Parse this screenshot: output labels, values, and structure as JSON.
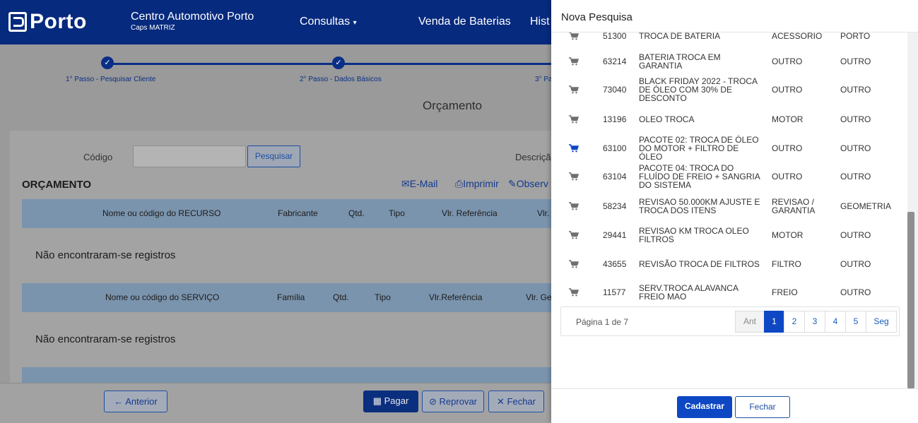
{
  "navbar": {
    "logo": "Porto",
    "company_name": "Centro Automotivo Porto",
    "company_sub": "Caps MATRIZ",
    "links": [
      "Consultas",
      "Venda de Baterias",
      "Hist"
    ]
  },
  "stepper": {
    "steps": [
      "1° Passo - Pesquisar Cliente",
      "2° Passo - Dados Básicos",
      "3° Pa"
    ]
  },
  "main": {
    "title": "Orçamento",
    "code_label": "Código",
    "search_button": "Pesquisar",
    "desc_label": "Descriçã",
    "section_title": "ORÇAMENTO",
    "actions": [
      "E-Mail",
      "Imprimir",
      "Observ"
    ],
    "resources_table": {
      "headers": [
        "Nome ou código do RECURSO",
        "Fabricante",
        "Qtd.",
        "Tipo",
        "Vlr. Referência",
        "Vlr."
      ],
      "empty": "Não encontraram-se registros"
    },
    "services_table": {
      "headers": [
        "Nome ou código do SERVIÇO",
        "Família",
        "Qtd.",
        "Tipo",
        "Vlr.Referência",
        "Vlr. Ge"
      ],
      "empty": "Não encontraram-se registros"
    },
    "footer_buttons": {
      "previous": "Anterior",
      "pay": "Pagar",
      "reject": "Reprovar",
      "close": "Fechar"
    }
  },
  "modal": {
    "title": "Nova Pesquisa",
    "rows": [
      {
        "code": "51300",
        "desc": "TROCA DE BATERIA",
        "family": "ACESSORIO",
        "group": "PORTO"
      },
      {
        "code": "63214",
        "desc": "BATERIA TROCA EM GARANTIA",
        "family": "OUTRO",
        "group": "OUTRO"
      },
      {
        "code": "73040",
        "desc": "BLACK FRIDAY 2022 - TROCA DE ÓLEO COM 30% DE DESCONTO",
        "family": "OUTRO",
        "group": "OUTRO"
      },
      {
        "code": "13196",
        "desc": "OLEO TROCA",
        "family": "MOTOR",
        "group": "OUTRO"
      },
      {
        "code": "63100",
        "desc": "PACOTE 02: TROCA DE ÓLEO DO MOTOR + FILTRO DE ÓLEO",
        "family": "OUTRO",
        "group": "OUTRO"
      },
      {
        "code": "63104",
        "desc": "PACOTE 04: TROCA DO FLUÍDO DE FREIO + SANGRIA DO SISTEMA",
        "family": "OUTRO",
        "group": "OUTRO"
      },
      {
        "code": "58234",
        "desc": "REVISAO 50.000KM AJUSTE E TROCA DOS ITENS",
        "family": "REVISAO / GARANTIA",
        "group": "GEOMETRIA"
      },
      {
        "code": "29441",
        "desc": "REVISAO KM TROCA OLEO FILTROS",
        "family": "MOTOR",
        "group": "OUTRO"
      },
      {
        "code": "43655",
        "desc": "REVISÃO TROCA DE FILTROS",
        "family": "FILTRO",
        "group": "OUTRO"
      },
      {
        "code": "11577",
        "desc": "SERV.TROCA ALAVANCA FREIO MAO",
        "family": "FREIO",
        "group": "OUTRO"
      }
    ],
    "pager": {
      "info": "Página 1 de 7",
      "prev": "Ant",
      "pages": [
        "1",
        "2",
        "3",
        "4",
        "5"
      ],
      "next": "Seg",
      "current": "1"
    },
    "buttons": {
      "save": "Cadastrar",
      "close": "Fechar"
    },
    "colors": {
      "primary": "#0d47c4",
      "navbar": "#062a7e"
    }
  }
}
